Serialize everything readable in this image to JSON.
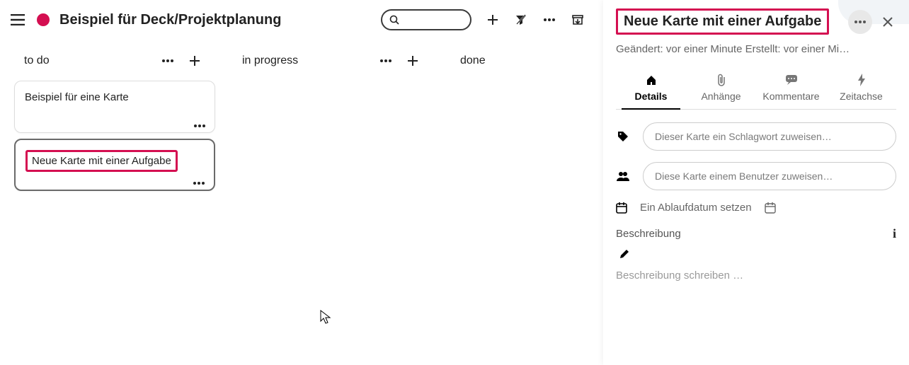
{
  "header": {
    "board_title": "Beispiel für Deck/Projektplanung",
    "search_placeholder": ""
  },
  "lists": [
    {
      "title": "to do"
    },
    {
      "title": "in progress"
    },
    {
      "title": "done"
    }
  ],
  "cards": {
    "card0": "Beispiel für eine Karte",
    "card1": "Neue Karte mit einer Aufgabe"
  },
  "detail": {
    "title": "Neue Karte mit einer Aufgabe",
    "meta": "Geändert: vor einer Minute Erstellt: vor einer Mi…",
    "tabs": {
      "details": "Details",
      "attachments": "Anhänge",
      "comments": "Kommentare",
      "timeline": "Zeitachse"
    },
    "form": {
      "tag_placeholder": "Dieser Karte ein Schlagwort zuweisen…",
      "user_placeholder": "Diese Karte einem Benutzer zuweisen…",
      "due_label": "Ein Ablaufdatum setzen"
    },
    "description": {
      "label": "Beschreibung",
      "placeholder": "Beschreibung schreiben …"
    }
  },
  "colors": {
    "accent": "#d40f51"
  }
}
